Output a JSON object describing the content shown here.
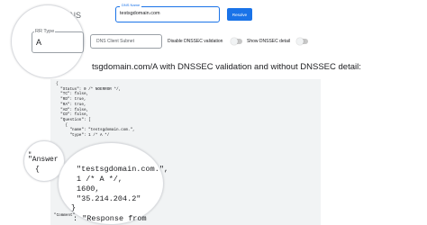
{
  "header": {
    "title_fragment": "ic DNS",
    "dns_name_label": "DNS Name",
    "dns_name_value": "testsgdomain.com",
    "resolve_label": "Resolve"
  },
  "options": {
    "rr_type_label": "RR Type",
    "rr_type_value": "A",
    "subnet_label": "DNS Client Subnet",
    "disable_dnssec_label": "Disable DNSSEC validation",
    "show_dnssec_label": "Show DNSSEC detail"
  },
  "result": {
    "heading": "tsgdomain.com/A with DNSSEC validation and without DNSSEC detail:",
    "code_lines": [
      "{",
      "  \"Status\": 0 /* NOERROR */,",
      "  \"TC\": false,",
      "  \"RD\": true,",
      "  \"RA\": true,",
      "  \"AD\": false,",
      "  \"CD\": false,",
      "  \"Question\": [",
      "    {",
      "      \"name\": \"testsgdomain.com.\",",
      "      \"type\": 1 /* A */",
      "",
      "",
      "",
      "",
      "",
      "",
      "",
      "",
      "",
      "",
      "",
      "",
      "",
      "",
      ""
    ]
  },
  "magnifier": {
    "quote_chars": "\"",
    "brace_open": "{",
    "answer_key": "\"Answer",
    "ans_name": "\"testsgdomain.com.\",",
    "ans_type": "1 /* A */,",
    "ans_ttl": "1600,",
    "ans_data": "\"35.214.204.2\"",
    "ans_close": "}",
    "comment_key": "\"Comment\"",
    "comment_val": ": \"Response from "
  }
}
